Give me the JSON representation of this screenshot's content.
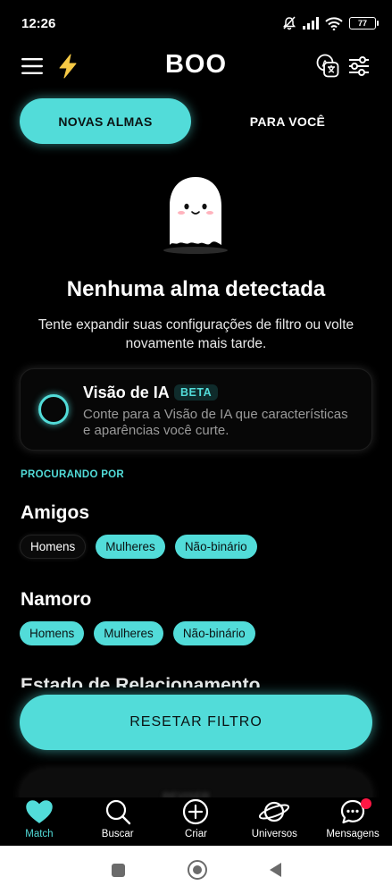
{
  "status_bar": {
    "time": "12:26",
    "battery": "77"
  },
  "app": {
    "title": "BOO"
  },
  "tabs": [
    {
      "label": "NOVAS ALMAS",
      "active": true
    },
    {
      "label": "PARA VOCÊ",
      "active": false
    }
  ],
  "empty_state": {
    "title": "Nenhuma alma detectada",
    "subtitle": "Tente expandir suas configurações de filtro ou volte novamente mais tarde."
  },
  "ai_vision": {
    "title": "Visão de IA",
    "badge": "BETA",
    "description": "Conte para a Visão de IA que características e aparências você curte."
  },
  "filters": {
    "section_label": "PROCURANDO POR",
    "groups": [
      {
        "title": "Amigos",
        "options": [
          {
            "label": "Homens",
            "selected": false
          },
          {
            "label": "Mulheres",
            "selected": true
          },
          {
            "label": "Não-binário",
            "selected": true
          }
        ]
      },
      {
        "title": "Namoro",
        "options": [
          {
            "label": "Homens",
            "selected": true
          },
          {
            "label": "Mulheres",
            "selected": true
          },
          {
            "label": "Não-binário",
            "selected": true
          }
        ]
      }
    ],
    "partial_section_title": "Estado de Relacionamento"
  },
  "reset_button": {
    "label": "RESETAR FILTRO"
  },
  "hidden_card": {
    "label": "REVISER"
  },
  "bottom_nav": [
    {
      "label": "Match",
      "icon": "heart-icon",
      "active": true
    },
    {
      "label": "Buscar",
      "icon": "search-icon",
      "active": false
    },
    {
      "label": "Criar",
      "icon": "plus-circle-icon",
      "active": false
    },
    {
      "label": "Universos",
      "icon": "planet-icon",
      "active": false
    },
    {
      "label": "Mensagens",
      "icon": "chat-icon",
      "active": false,
      "badge": true
    }
  ],
  "colors": {
    "accent": "#52dcd9",
    "background": "#000000",
    "badge": "#ff1744"
  }
}
